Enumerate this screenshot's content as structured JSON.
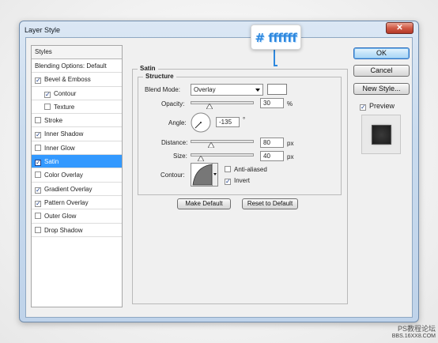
{
  "window": {
    "title": "Layer Style",
    "close_glyph": "✕"
  },
  "sidebar": {
    "header": "Styles",
    "items": [
      {
        "label": "Blending Options: Default",
        "checkbox": false,
        "checked": false,
        "indent": false,
        "selected": false
      },
      {
        "label": "Bevel & Emboss",
        "checkbox": true,
        "checked": true,
        "indent": false,
        "selected": false
      },
      {
        "label": "Contour",
        "checkbox": true,
        "checked": true,
        "indent": true,
        "selected": false
      },
      {
        "label": "Texture",
        "checkbox": true,
        "checked": false,
        "indent": true,
        "selected": false
      },
      {
        "label": "Stroke",
        "checkbox": true,
        "checked": false,
        "indent": false,
        "selected": false
      },
      {
        "label": "Inner Shadow",
        "checkbox": true,
        "checked": true,
        "indent": false,
        "selected": false
      },
      {
        "label": "Inner Glow",
        "checkbox": true,
        "checked": false,
        "indent": false,
        "selected": false
      },
      {
        "label": "Satin",
        "checkbox": true,
        "checked": true,
        "indent": false,
        "selected": true
      },
      {
        "label": "Color Overlay",
        "checkbox": true,
        "checked": false,
        "indent": false,
        "selected": false
      },
      {
        "label": "Gradient Overlay",
        "checkbox": true,
        "checked": true,
        "indent": false,
        "selected": false
      },
      {
        "label": "Pattern Overlay",
        "checkbox": true,
        "checked": true,
        "indent": false,
        "selected": false
      },
      {
        "label": "Outer Glow",
        "checkbox": true,
        "checked": false,
        "indent": false,
        "selected": false
      },
      {
        "label": "Drop Shadow",
        "checkbox": true,
        "checked": false,
        "indent": false,
        "selected": false
      }
    ]
  },
  "satin": {
    "group_title": "Satin",
    "structure_title": "Structure",
    "blend_mode_label": "Blend Mode:",
    "blend_mode_value": "Overlay",
    "blend_color": "#ffffff",
    "opacity_label": "Opacity:",
    "opacity_value": "30",
    "opacity_unit": "%",
    "opacity_fraction": 0.3,
    "angle_label": "Angle:",
    "angle_value": "-135",
    "angle_unit": "°",
    "distance_label": "Distance:",
    "distance_value": "80",
    "distance_unit": "px",
    "distance_fraction": 0.32,
    "size_label": "Size:",
    "size_value": "40",
    "size_unit": "px",
    "size_fraction": 0.16,
    "contour_label": "Contour:",
    "anti_aliased_label": "Anti-aliased",
    "anti_aliased_checked": false,
    "invert_label": "Invert",
    "invert_checked": true,
    "make_default_label": "Make Default",
    "reset_default_label": "Reset to Default"
  },
  "actions": {
    "ok_label": "OK",
    "cancel_label": "Cancel",
    "new_style_label": "New Style...",
    "preview_label": "Preview",
    "preview_checked": true
  },
  "callout": {
    "text": "# ffffff",
    "color": "#2e88de"
  },
  "watermark": {
    "line1": "PS教程论坛",
    "line2": "BBS.16XX8.COM"
  },
  "colors": {
    "selection": "#3399ff",
    "accent_border": "#2d6ebf"
  }
}
